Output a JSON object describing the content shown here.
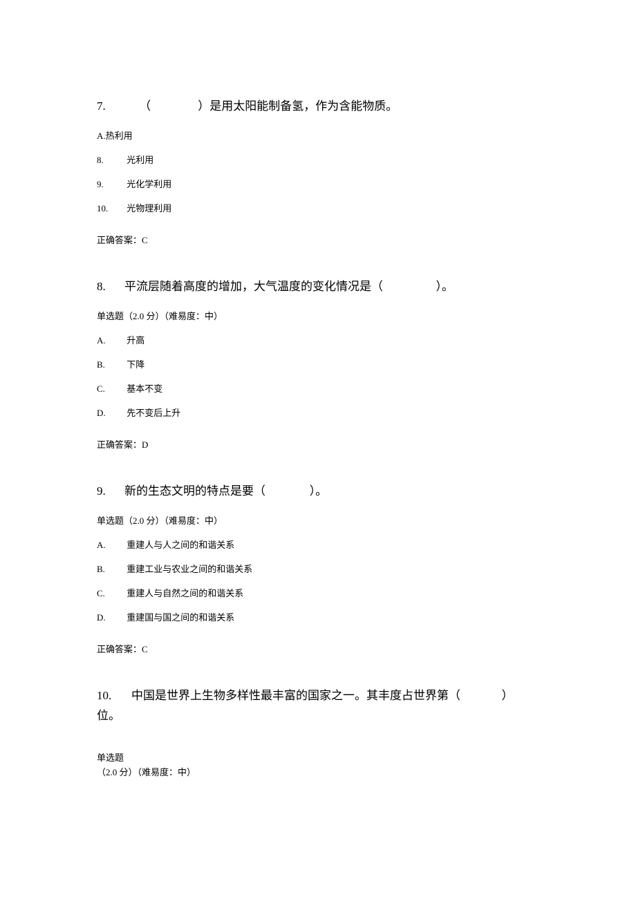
{
  "q7": {
    "num": "7.",
    "open": "（",
    "close": "）是用太阳能制备氢，作为含能物质。",
    "optA_label": "A.",
    "optA_text": "热利用",
    "optB_num": "8.",
    "optB_text": "光利用",
    "optC_num": "9.",
    "optC_text": "光化学利用",
    "optD_num": "10.",
    "optD_text": "光物理利用",
    "answer": "正确答案：C"
  },
  "q8": {
    "num": "8.",
    "stem_pre": "平流层随着高度的增加，大气温度的变化情况是（",
    "stem_post": "）。",
    "meta": "单选题（2.0 分）（难易度：中）",
    "a_label": "A.",
    "a_text": "升高",
    "b_label": "B.",
    "b_text": "下降",
    "c_label": "C.",
    "c_text": "基本不变",
    "d_label": "D.",
    "d_text": "先不变后上升",
    "answer": "正确答案：D"
  },
  "q9": {
    "num": "9.",
    "stem_pre": "新的生态文明的特点是要（",
    "stem_post": "）。",
    "meta": "单选题（2.0 分）（难易度：中）",
    "a_label": "A.",
    "a_text": "重建人与人之间的和谐关系",
    "b_label": "B.",
    "b_text": "重建工业与农业之间的和谐关系",
    "c_label": "C.",
    "c_text": "重建人与自然之间的和谐关系",
    "d_label": "D.",
    "d_text": "重建国与国之间的和谐关系",
    "answer": "正确答案：C"
  },
  "q10": {
    "num": "10.",
    "stem_pre": "中国是世界上生物多样性最丰富的国家之一。其丰度占世界第（",
    "stem_post": "）",
    "stem_line2": "位。",
    "meta1": "单选题",
    "meta2": "（2.0 分）（难易度：中）"
  }
}
